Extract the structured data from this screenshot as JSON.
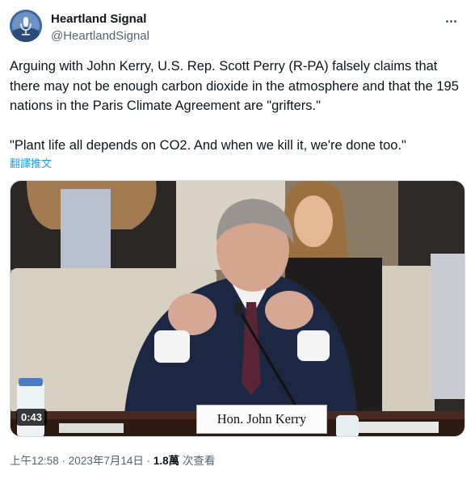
{
  "account": {
    "name": "Heartland Signal",
    "handle": "@HeartlandSignal"
  },
  "tweet": {
    "text": "Arguing with John Kerry, U.S. Rep. Scott Perry (R-PA) falsely claims that there may not be enough carbon dioxide in the atmosphere and that the 195 nations in the Paris Climate Agreement are \"grifters.\"\n\n\"Plant life all depends on CO2. And when we kill it, we're done too.\"",
    "translate_label": "翻譯推文"
  },
  "video": {
    "duration": "0:43",
    "nameplate": "Hon. John Kerry"
  },
  "meta": {
    "time": "上午12:58",
    "separator": " · ",
    "date": "2023年7月14日",
    "views_count": "1.8萬",
    "views_label": " 次查看"
  },
  "icons": {
    "more": "more-dots-icon",
    "avatar": "microphone-logo-icon"
  },
  "colors": {
    "link": "#1d9bf0",
    "secondary_text": "#536471",
    "primary_text": "#0f1419"
  }
}
